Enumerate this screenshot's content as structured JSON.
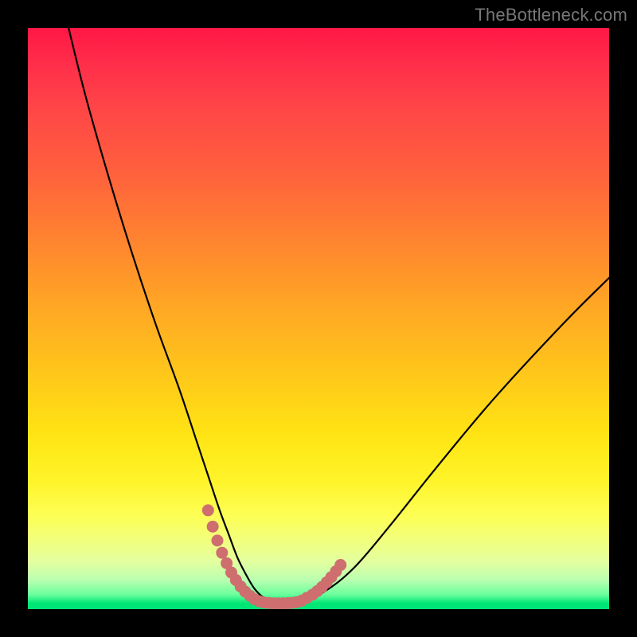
{
  "watermark": {
    "text": "TheBottleneck.com"
  },
  "gradient_colors": {
    "top": "#ff1744",
    "mid_upper": "#ff8230",
    "mid": "#ffe414",
    "lower": "#fdff55",
    "green": "#00e676"
  },
  "chart_data": {
    "type": "line",
    "title": "",
    "xlabel": "",
    "ylabel": "",
    "xlim": [
      0,
      100
    ],
    "ylim": [
      0,
      100
    ],
    "series": [
      {
        "name": "bottleneck-curve",
        "color": "#000000",
        "x": [
          7,
          10,
          14,
          18,
          22,
          26,
          29,
          31,
          33,
          34.5,
          36,
          37.5,
          39,
          40.5,
          42,
          44,
          47,
          51,
          56,
          62,
          70,
          80,
          92,
          100
        ],
        "y": [
          100,
          88,
          74,
          61,
          49,
          38,
          29,
          23,
          17,
          13,
          9,
          6,
          3.5,
          2,
          1.2,
          1.0,
          1.2,
          3.0,
          7,
          14,
          24,
          36,
          49,
          57
        ]
      },
      {
        "name": "valley-highlight-left",
        "color": "#cf6e6e",
        "x": [
          31.0,
          31.8,
          32.6,
          33.4,
          34.2,
          35.0,
          35.8,
          36.6,
          37.4,
          38.2,
          39.0,
          39.8,
          40.6,
          41.5
        ],
        "y": [
          17.0,
          14.2,
          11.8,
          9.7,
          7.9,
          6.3,
          5.0,
          3.9,
          3.0,
          2.3,
          1.7,
          1.35,
          1.15,
          1.05
        ]
      },
      {
        "name": "valley-highlight-bottom",
        "color": "#cf6e6e",
        "x": [
          41.5,
          42.3,
          43.1,
          43.9,
          44.7,
          45.5,
          46.3,
          47.1,
          48.0
        ],
        "y": [
          1.05,
          1.0,
          1.0,
          1.0,
          1.02,
          1.08,
          1.2,
          1.45,
          1.95
        ]
      },
      {
        "name": "valley-highlight-right",
        "color": "#cf6e6e",
        "x": [
          49.0,
          49.8,
          50.6,
          51.4,
          52.2,
          53.0,
          53.8
        ],
        "y": [
          2.5,
          3.1,
          3.8,
          4.6,
          5.5,
          6.5,
          7.6
        ]
      }
    ]
  }
}
